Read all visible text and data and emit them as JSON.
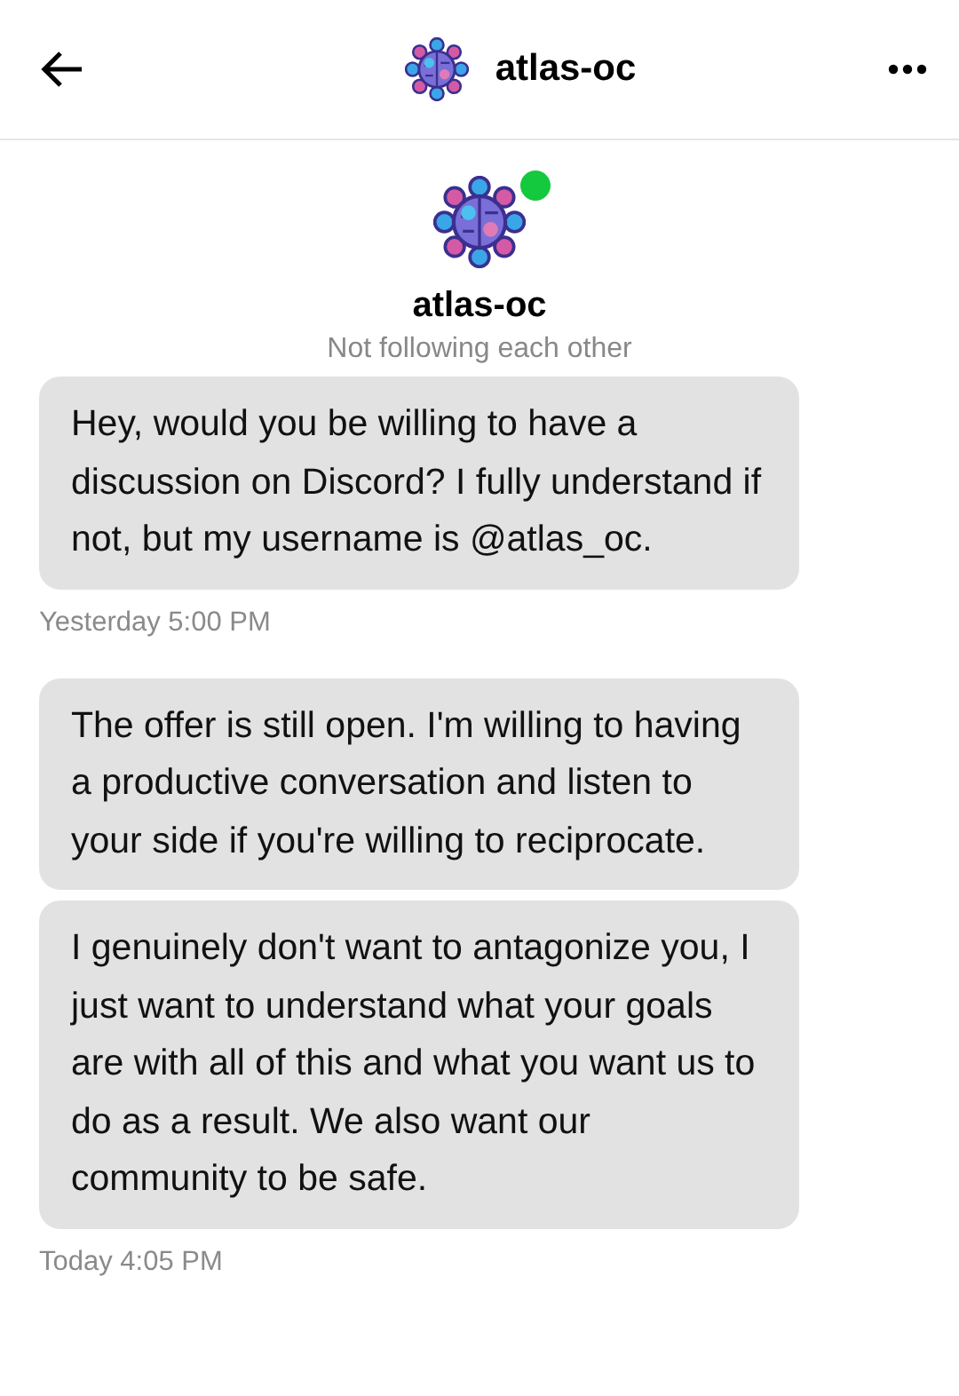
{
  "header": {
    "title": "atlas-oc"
  },
  "profile": {
    "name": "atlas-oc",
    "online": true,
    "relation": "Not following each other"
  },
  "groups": [
    {
      "messages": [
        "Hey, would you be willing to have a discussion on Discord? I fully understand if not, but my username is @atlas_oc."
      ],
      "timestamp": "Yesterday 5:00 PM"
    },
    {
      "messages": [
        "The offer is still open. I'm willing to having a productive conversation and listen to your side if you're willing to reciprocate.",
        "I genuinely don't want to antagonize you, I just want to understand what your goals are with all of this and what you want us to do as a result. We also want our community to be safe."
      ],
      "timestamp": "Today 4:05 PM"
    }
  ]
}
